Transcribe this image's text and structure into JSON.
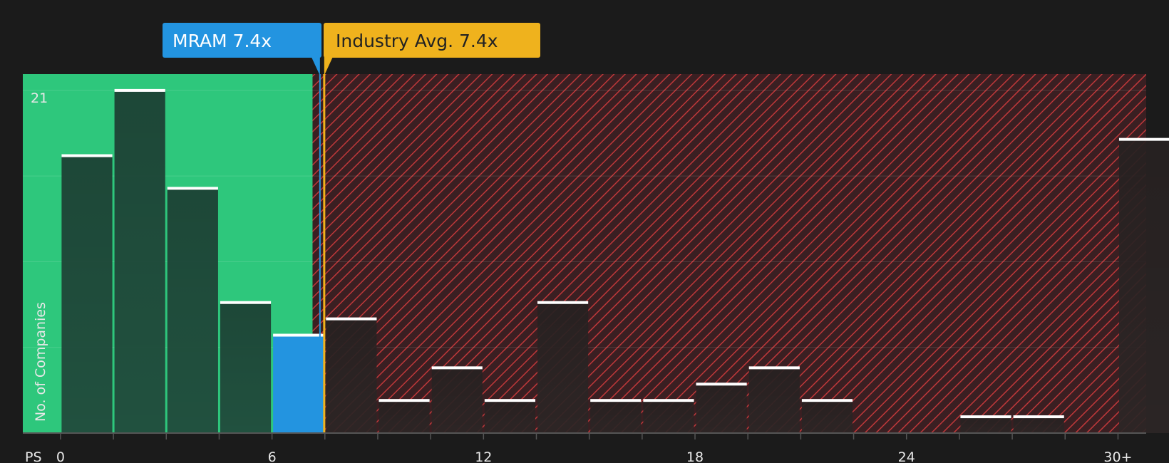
{
  "chart_data": {
    "type": "bar",
    "ylabel": "No. of Companies",
    "xlabel": "PS",
    "x_ticks": [
      "0",
      "6",
      "12",
      "18",
      "24",
      "30+"
    ],
    "y_tick_label": "21",
    "ylim": [
      0,
      22
    ],
    "xlim": [
      -1.07,
      30.8
    ],
    "bin_width": 1.5,
    "bars": [
      {
        "x": 0,
        "value": 17
      },
      {
        "x": 1.5,
        "value": 21
      },
      {
        "x": 3,
        "value": 15
      },
      {
        "x": 4.5,
        "value": 8
      },
      {
        "x": 6,
        "value": 6,
        "highlight": true
      },
      {
        "x": 7.5,
        "value": 7
      },
      {
        "x": 9,
        "value": 2
      },
      {
        "x": 10.5,
        "value": 4
      },
      {
        "x": 12,
        "value": 2
      },
      {
        "x": 13.5,
        "value": 8
      },
      {
        "x": 15,
        "value": 2
      },
      {
        "x": 16.5,
        "value": 2
      },
      {
        "x": 18,
        "value": 3
      },
      {
        "x": 19.5,
        "value": 4
      },
      {
        "x": 21,
        "value": 2
      },
      {
        "x": 22.5,
        "value": 0
      },
      {
        "x": 24,
        "value": 0
      },
      {
        "x": 25.5,
        "value": 1
      },
      {
        "x": 27,
        "value": 1
      },
      {
        "x": 28.5,
        "value": 0
      },
      {
        "x": 30,
        "value": 18
      }
    ],
    "company": {
      "label": "MRAM 7.4x",
      "value": 7.4,
      "color": "#2394e0"
    },
    "industry_avg": {
      "label": "Industry Avg. 7.4x",
      "value": 7.4,
      "color": "#efb21d"
    },
    "undervalued_region": [
      -1.07,
      7.15
    ],
    "overvalued_region": [
      7.15,
      30.8
    ],
    "grid": true,
    "colors": {
      "background": "#1b1b1b",
      "green_zone": "#2ec77c",
      "red_zone": "#3a1f22",
      "hatch": "#c0383a",
      "bar_green_zone": "#21473a",
      "bar_red_zone": "#2c2626",
      "highlight_bar": "#2394e0",
      "bar_cap": "#ffffff"
    }
  }
}
